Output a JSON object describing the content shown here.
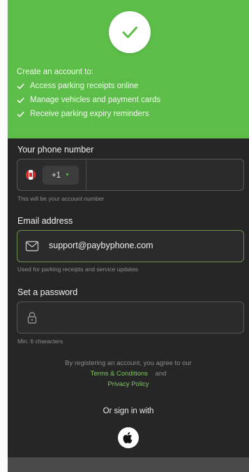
{
  "header": {
    "benefits_title": "Create an account to:",
    "benefits": [
      "Access parking receipts online",
      "Manage vehicles and payment cards",
      "Receive parking expiry reminders"
    ]
  },
  "phone": {
    "label": "Your phone number",
    "country_code": "+1",
    "value": "",
    "helper": "This will be your account number"
  },
  "email": {
    "label": "Email address",
    "value": "support@paybyphone.com",
    "helper": "Used for parking receipts and service updates"
  },
  "password": {
    "label": "Set a password",
    "value": "",
    "helper": "Min. 6 characters"
  },
  "terms": {
    "text": "By registering an account, you agree to our",
    "terms_link": "Terms & Conditions",
    "and": "and",
    "privacy_link": "Privacy Policy"
  },
  "signin": {
    "label": "Or sign in with",
    "provider_icon": "apple-icon"
  },
  "colors": {
    "brand_green": "#5cbd48",
    "background": "#262626",
    "link_green": "#7ec95e"
  }
}
